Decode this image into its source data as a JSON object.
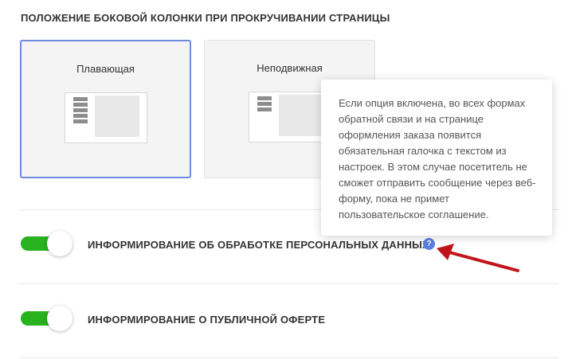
{
  "section": {
    "title": "Положение боковой колонки при прокручивании страницы"
  },
  "cards": [
    {
      "label": "Плавающая",
      "selected": true
    },
    {
      "label": "Неподвижная",
      "selected": false
    }
  ],
  "options": [
    {
      "label": "Информирование об обработке персональных данных",
      "enabled": true,
      "help_icon": "?"
    },
    {
      "label": "Информирование о публичной оферте",
      "enabled": true
    }
  ],
  "tooltip": {
    "text": "Если опция включена, во всех формах обратной связи и на странице оформления заказа появится обязательная галочка с текстом из настроек. В этом случае посетитель не сможет отправить сообщение через веб-форму, пока не примет пользовательское соглашение."
  },
  "colors": {
    "toggle_on": "#27b21e",
    "selected_border": "#6f8be0",
    "help_icon": "#5b7fe0",
    "arrow": "#c0141a"
  }
}
